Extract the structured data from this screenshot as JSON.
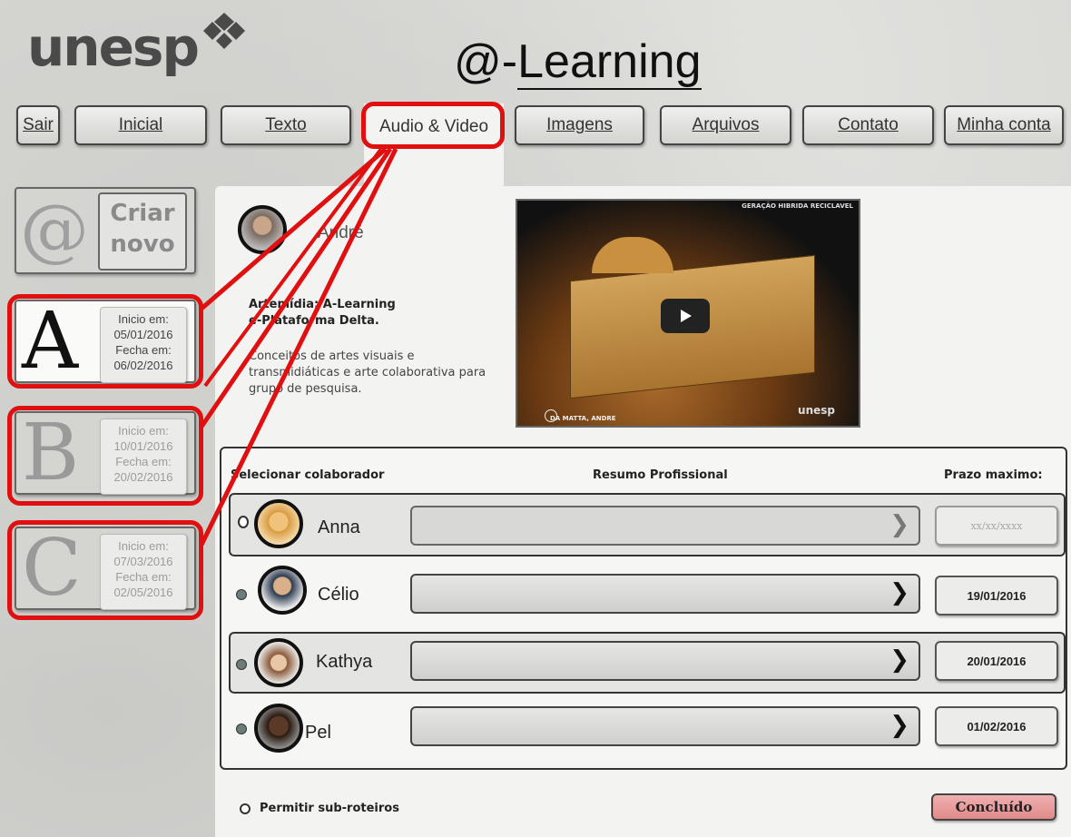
{
  "logo": {
    "text": "unesp"
  },
  "app_title": {
    "prefix": "@-",
    "main": "Learning"
  },
  "nav": {
    "tabs": [
      {
        "label": "Sair"
      },
      {
        "label": "Inicial"
      },
      {
        "label": "Texto"
      },
      {
        "label": "Audio & Video"
      },
      {
        "label": "Imagens"
      },
      {
        "label": "Arquivos"
      },
      {
        "label": "Contato"
      },
      {
        "label": "Minha conta"
      }
    ]
  },
  "sidebar": {
    "create": {
      "icon_glyph": "@",
      "line1": "Criar",
      "line2": "novo"
    },
    "items": [
      {
        "letter": "A",
        "start_label": "Inicio em:",
        "start": "05/01/2016",
        "end_label": "Fecha em:",
        "end": "06/02/2016"
      },
      {
        "letter": "B",
        "start_label": "Inicio em:",
        "start": "10/01/2016",
        "end_label": "Fecha em:",
        "end": "20/02/2016"
      },
      {
        "letter": "C",
        "start_label": "Inicio em:",
        "start": "07/03/2016",
        "end_label": "Fecha em:",
        "end": "02/05/2016"
      }
    ]
  },
  "project": {
    "author": "André",
    "title_line1": "Artemídia: A-Learning",
    "title_line2": "e-Plataforma Delta.",
    "description": "Conceitos de artes visuais e transmidiáticas e arte colaborativa para grupo de pesquisa."
  },
  "video": {
    "top_caption": "GERAÇÃO HIBRIDA RECICLAVEL",
    "bottom_caption": "DA MATTA, ANDRE",
    "brand": "unesp"
  },
  "table": {
    "col_select": "Selecionar colaborador",
    "col_resumo": "Resumo  Profissional",
    "col_prazo": "Prazo maximo:",
    "rows": [
      {
        "name": "Anna",
        "prazo": "xx/xx/xxxx"
      },
      {
        "name": "Célio",
        "prazo": "19/01/2016"
      },
      {
        "name": "Kathya",
        "prazo": "20/01/2016"
      },
      {
        "name": "Pel",
        "prazo": "01/02/2016"
      }
    ]
  },
  "footer": {
    "subroteiros": "Permitir sub-roteiros",
    "done": "Concluído"
  }
}
